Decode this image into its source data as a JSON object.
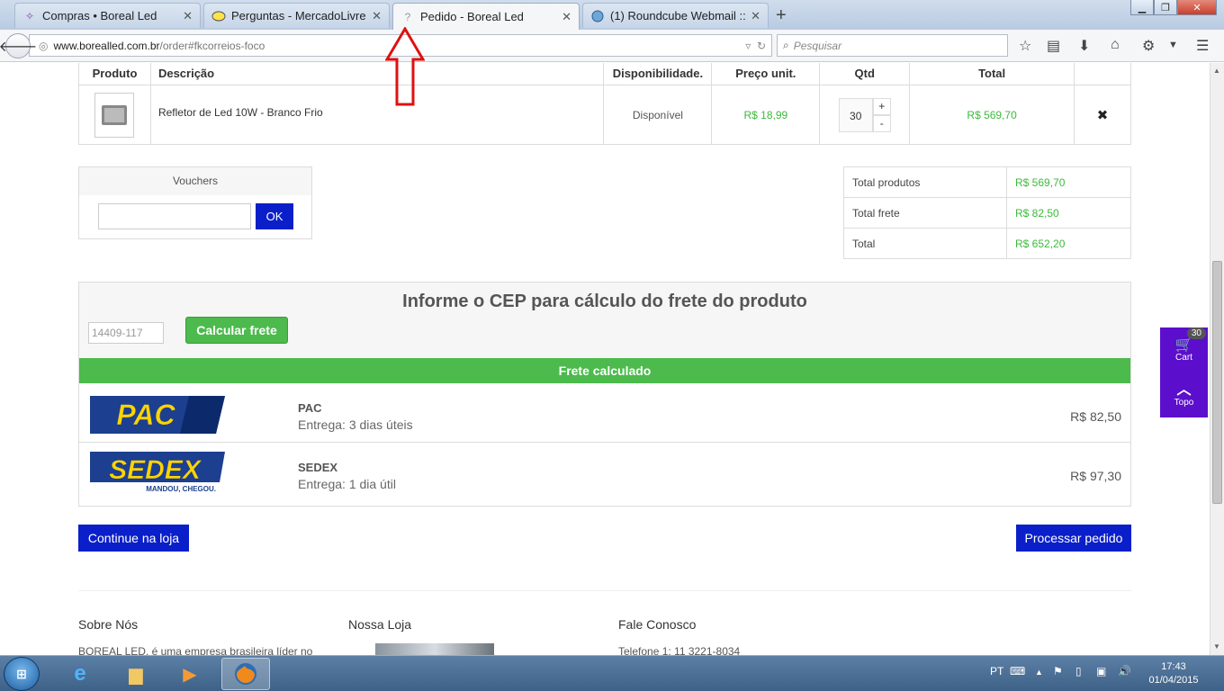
{
  "browser": {
    "tabs": [
      {
        "label": "Compras • Boreal Led",
        "icon": "boreal-icon"
      },
      {
        "label": "Perguntas - MercadoLivre",
        "icon": "mercadolivre-icon"
      },
      {
        "label": "Pedido - Boreal Led",
        "icon": "unknown-page-icon",
        "active": true
      },
      {
        "label": "(1) Roundcube Webmail :: ...",
        "icon": "roundcube-icon"
      }
    ],
    "new_tab": "+",
    "url_host": "www.borealled.com.br",
    "url_path": "/order#fkcorreios-foco",
    "search_placeholder": "Pesquisar"
  },
  "cart": {
    "headers": [
      "Produto",
      "Descrição",
      "Disponibilidade.",
      "Preço unit.",
      "Qtd",
      "Total"
    ],
    "item": {
      "description": "Refletor de Led 10W - Branco Frio",
      "availability": "Disponível",
      "unit_price": "R$ 18,99",
      "qty": "30",
      "plus": "+",
      "minus": "-",
      "total": "R$ 569,70",
      "remove": "✖"
    }
  },
  "vouchers": {
    "title": "Vouchers",
    "ok": "OK"
  },
  "totals": [
    {
      "label": "Total produtos",
      "value": "R$ 569,70"
    },
    {
      "label": "Total frete",
      "value": "R$ 82,50"
    },
    {
      "label": "Total",
      "value": "R$ 652,20"
    }
  ],
  "frete": {
    "title": "Informe o CEP para cálculo do frete do produto",
    "cep_value": "14409-117",
    "calc_button": "Calcular frete",
    "banner": "Frete calculado",
    "options": [
      {
        "logo": "PAC",
        "name": "PAC",
        "eta": "Entrega: 3 dias úteis",
        "price": "R$ 82,50"
      },
      {
        "logo": "SEDEX",
        "tagline": "MANDOU, CHEGOU.",
        "name": "SEDEX",
        "eta": "Entrega: 1 dia útil",
        "price": "R$ 97,30"
      }
    ]
  },
  "actions": {
    "continue": "Continue na loja",
    "process": "Processar pedido"
  },
  "footer": {
    "sobre_title": "Sobre Nós",
    "sobre_text": "BOREAL LED, é uma empresa brasileira líder no",
    "loja_title": "Nossa Loja",
    "contato_title": "Fale Conosco",
    "contato_text": "Telefone 1: 11 3221-8034"
  },
  "side_widget": {
    "cart_label": "Cart",
    "cart_count": "30",
    "top_label": "Topo"
  },
  "taskbar": {
    "language": "PT",
    "time": "17:43",
    "date": "01/04/2015"
  },
  "colors": {
    "accent_blue": "#0a1fc9",
    "green": "#4cba4c",
    "price_green": "#3cba3c",
    "widget_purple": "#5b0fcc",
    "arrow_red": "#e01010"
  }
}
